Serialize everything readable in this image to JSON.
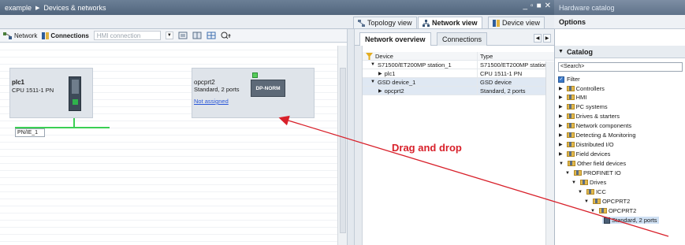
{
  "title": {
    "project": "example",
    "section": "Devices & networks",
    "controls": [
      "_",
      "▫",
      "■",
      "✕"
    ]
  },
  "hardware_catalog_title": "Hardware catalog",
  "view_tabs": {
    "topology": "Topology view",
    "network": "Network view",
    "device": "Device view"
  },
  "options_label": "Options",
  "toolbar": {
    "network": "Network",
    "connections": "Connections",
    "hmi_connection": "HMI connection"
  },
  "devices": {
    "plc": {
      "name": "plc1",
      "type": "CPU 1511-1 PN"
    },
    "gsd": {
      "name": "opcprt2",
      "type": "Standard, 2 ports",
      "status": "Not assigned",
      "module": "DP-NORM"
    },
    "subnet": "PN/IE_1"
  },
  "overview": {
    "tabs": {
      "overview": "Network overview",
      "connections": "Connections"
    },
    "headers": {
      "device": "Device",
      "type": "Type"
    },
    "rows": [
      {
        "device": "S71500/ET200MP station_1",
        "type": "S71500/ET200MP station",
        "level": 1,
        "expanded": true
      },
      {
        "device": "plc1",
        "type": "CPU 1511-1 PN",
        "level": 2,
        "expanded": false
      },
      {
        "device": "GSD device_1",
        "type": "GSD device",
        "level": 1,
        "expanded": true
      },
      {
        "device": "opcprt2",
        "type": "Standard, 2 ports",
        "level": 2,
        "expanded": false
      }
    ]
  },
  "catalog": {
    "header": "Catalog",
    "search_placeholder": "<Search>",
    "filter": "Filter",
    "items": [
      {
        "label": "Controllers"
      },
      {
        "label": "HMI"
      },
      {
        "label": "PC systems"
      },
      {
        "label": "Drives & starters"
      },
      {
        "label": "Network components"
      },
      {
        "label": "Detecting & Monitoring"
      },
      {
        "label": "Distributed I/O"
      },
      {
        "label": "Field devices"
      },
      {
        "label": "Other field devices"
      },
      {
        "label": "PROFINET IO"
      },
      {
        "label": "Drives"
      },
      {
        "label": "ICC"
      },
      {
        "label": "OPCPRT2"
      },
      {
        "label": "OPCPRT2"
      },
      {
        "label": "Standard, 2 ports"
      }
    ]
  },
  "annotation": {
    "text": "Drag and drop",
    "color": "#d8202a"
  }
}
